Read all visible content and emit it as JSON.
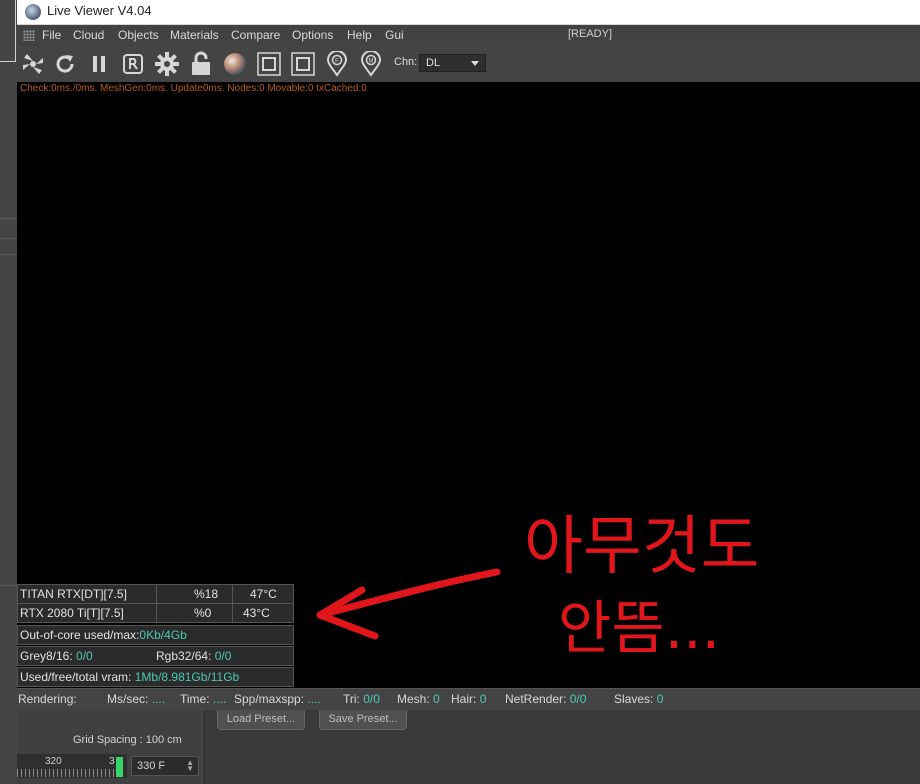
{
  "window": {
    "title": "Live Viewer V4.04"
  },
  "menu": {
    "items": [
      "File",
      "Cloud",
      "Objects",
      "Materials",
      "Compare",
      "Options",
      "Help",
      "Gui"
    ],
    "status": "[READY]"
  },
  "toolbar": {
    "icons": [
      "fan-icon",
      "refresh-icon",
      "pause-icon",
      "region-render-icon",
      "settings-gear-icon",
      "unlock-icon",
      "material-sphere-icon",
      "region-a-icon",
      "region-b-icon",
      "focus-pin-icon",
      "material-pin-icon"
    ],
    "channel_label": "Chn:",
    "channel_value": "DL"
  },
  "viewport": {
    "stats": "Check:0ms./0ms. MeshGen:0ms. Update0ms. Nodes:0 Movable:0 txCached:0"
  },
  "gpus": [
    {
      "name": "TITAN RTX[DT][7.5]",
      "usage": "%18",
      "temp": "47°C"
    },
    {
      "name": "RTX 2080 Ti[T][7.5]",
      "usage": "%0",
      "temp": "43°C"
    }
  ],
  "memory": {
    "out_of_core_label": "Out-of-core used/max:",
    "out_of_core_value": "0Kb/4Gb",
    "grey_label": "Grey8/16:",
    "grey_value": "0/0",
    "rgb_label": "Rgb32/64:",
    "rgb_value": "0/0",
    "vram_label": "Used/free/total vram:",
    "vram_value": "1Mb/8.981Gb/11Gb"
  },
  "annotation": {
    "line1": "아무것도",
    "line2": "안뜸...",
    "color": "#e0161b"
  },
  "status": {
    "rendering": "Rendering:",
    "ms_label": "Ms/sec:",
    "ms_value": "....",
    "time_label": "Time:",
    "time_value": "....",
    "spp_label": "Spp/maxspp:",
    "spp_value": "....",
    "tri_label": "Tri:",
    "tri_value": "0/0",
    "mesh_label": "Mesh:",
    "mesh_value": "0",
    "hair_label": "Hair:",
    "hair_value": "0",
    "net_label": "NetRender:",
    "net_value": "0/0",
    "slaves_label": "Slaves:",
    "slaves_value": "0"
  },
  "background_app": {
    "load_preset": "Load Preset...",
    "save_preset": "Save Preset...",
    "grid_spacing": "Grid Spacing : 100 cm",
    "timeline_start": "320",
    "timeline_mark": "3",
    "frame_value": "330 F"
  }
}
